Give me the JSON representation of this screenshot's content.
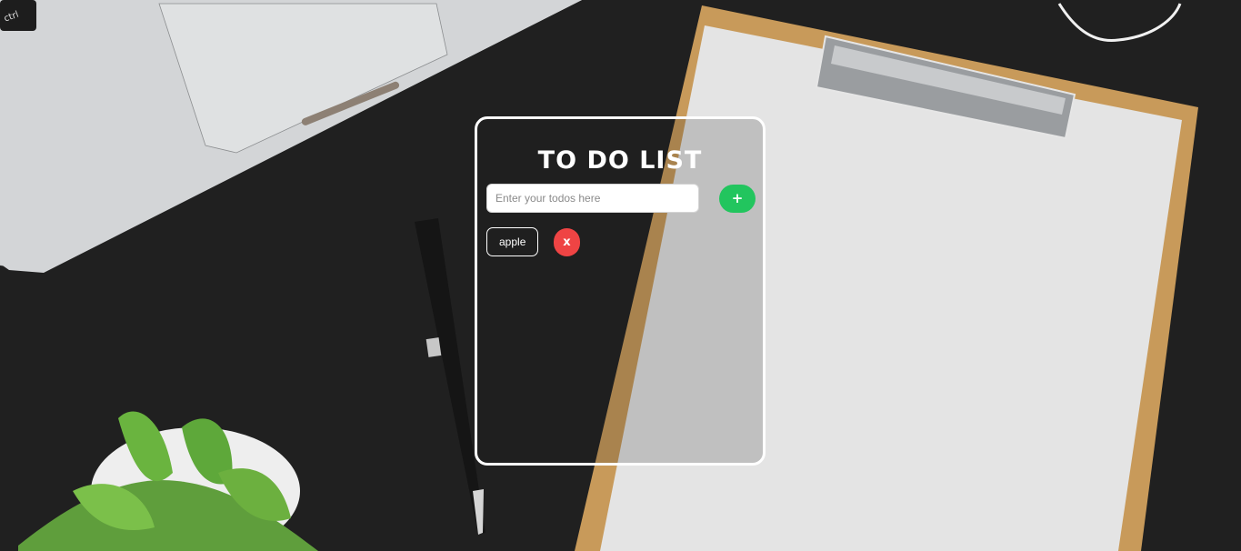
{
  "app": {
    "title": "TO DO LIST",
    "input": {
      "placeholder": "Enter your todos here",
      "value": ""
    },
    "add_button_label": "+",
    "todos": [
      {
        "text": "apple",
        "delete_label": "x"
      }
    ]
  },
  "background": {
    "keyboard_key_label": "ctrl"
  },
  "colors": {
    "desk": "#202020",
    "add_button": "#22c55e",
    "delete_button": "#ef4444",
    "card_border": "#ffffff",
    "clipboard": "#c89a5a",
    "paper": "#e4e4e4"
  },
  "icons": {
    "add": "plus-icon",
    "delete": "x-icon"
  }
}
